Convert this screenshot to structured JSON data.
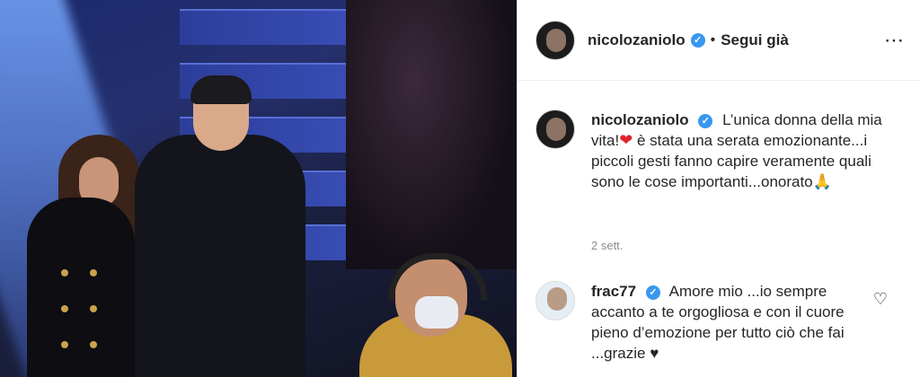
{
  "post": {
    "author": "nicolozaniolo",
    "follow_status": "Segui già",
    "separator": "•",
    "more_icon": "⋯",
    "caption_part1": "L’unica donna della mia vita!",
    "caption_part2": " è stata una serata emozionante...i piccoli gesti fanno capire veramente quali sono le cose importanti...onorato",
    "caption_heart": "❤",
    "caption_emoji": "🙏",
    "timestamp": "2 sett."
  },
  "comments": [
    {
      "username": "frac77",
      "text": "Amore mio ...io sempre accanto a te orgogliosa e con il cuore pieno d’emozione per tutto ciò che fai ...grazie ♥",
      "like_icon": "♡"
    }
  ],
  "colors": {
    "verified": "#3897f0",
    "text": "#262626",
    "muted": "#8e8e8e"
  }
}
